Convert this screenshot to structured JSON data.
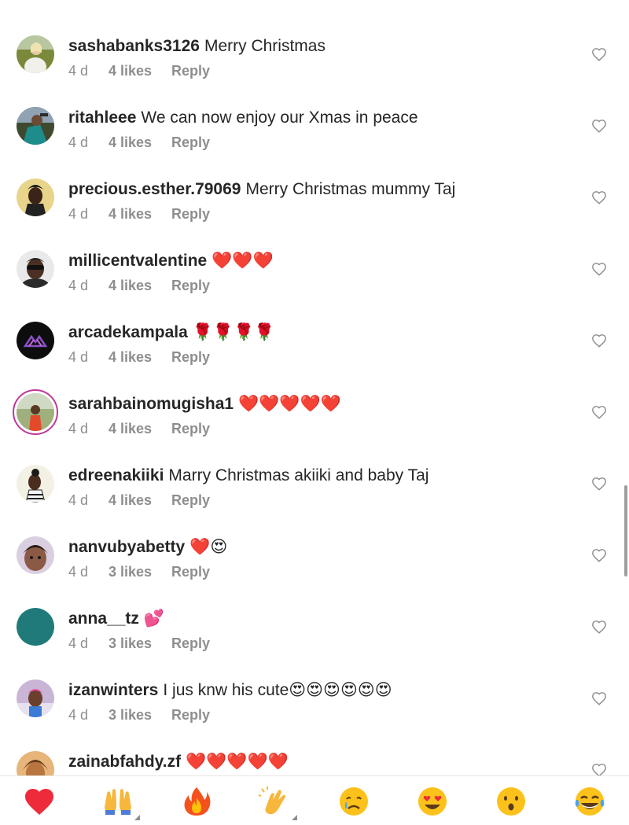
{
  "colors": {
    "text": "#262626",
    "muted": "#8e8e8e",
    "heart_red": "#ed2b3a",
    "story_ring": "#c0389a"
  },
  "comments": [
    {
      "username": "sashabanks3126",
      "text": "Merry Christmas",
      "age": "4 d",
      "likes": "4 likes",
      "reply": "Reply"
    },
    {
      "username": "ritahleee",
      "text": "We can now enjoy our Xmas in peace",
      "age": "4 d",
      "likes": "4 likes",
      "reply": "Reply"
    },
    {
      "username": "precious.esther.79069",
      "text": "Merry Christmas mummy Taj",
      "age": "4 d",
      "likes": "4 likes",
      "reply": "Reply"
    },
    {
      "username": "millicentvalentine",
      "text": "❤️❤️❤️",
      "age": "4 d",
      "likes": "4 likes",
      "reply": "Reply"
    },
    {
      "username": "arcadekampala",
      "text": "🌹🌹🌹🌹",
      "age": "4 d",
      "likes": "4 likes",
      "reply": "Reply"
    },
    {
      "username": "sarahbainomugisha1",
      "text": "❤️❤️❤️❤️❤️",
      "age": "4 d",
      "likes": "4 likes",
      "reply": "Reply"
    },
    {
      "username": "edreenakiiki",
      "text": "Marry Christmas akiiki and baby Taj",
      "age": "4 d",
      "likes": "4 likes",
      "reply": "Reply"
    },
    {
      "username": "nanvubyabetty",
      "text": "❤️😍",
      "age": "4 d",
      "likes": "3 likes",
      "reply": "Reply"
    },
    {
      "username": "anna__tz",
      "text": "💕",
      "age": "4 d",
      "likes": "3 likes",
      "reply": "Reply"
    },
    {
      "username": "izanwinters",
      "text": "I jus knw his cute😍😍😍😍😍😍",
      "age": "4 d",
      "likes": "3 likes",
      "reply": "Reply"
    },
    {
      "username": "zainabfahdy.zf",
      "text": "❤️❤️❤️❤️❤️",
      "age": "",
      "likes": "",
      "reply": ""
    }
  ],
  "emoji_bar": [
    {
      "icon": "red-heart-icon"
    },
    {
      "icon": "raising-hands-icon"
    },
    {
      "icon": "fire-icon"
    },
    {
      "icon": "clapping-hands-icon"
    },
    {
      "icon": "crying-face-icon"
    },
    {
      "icon": "heart-eyes-icon"
    },
    {
      "icon": "surprised-face-icon"
    },
    {
      "icon": "tears-of-joy-icon"
    }
  ]
}
